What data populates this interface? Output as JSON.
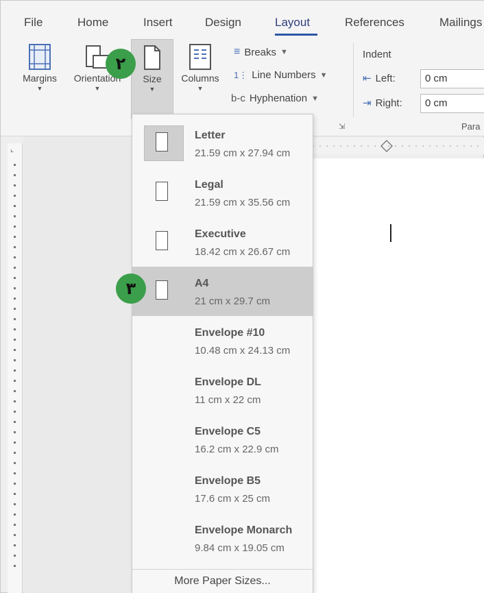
{
  "tabs": [
    "File",
    "Home",
    "Insert",
    "Design",
    "Layout",
    "References",
    "Mailings"
  ],
  "active_tab": "Layout",
  "ribbon": {
    "margins_label": "Margins",
    "orientation_label": "Orientation",
    "size_label": "Size",
    "columns_label": "Columns",
    "breaks_label": "Breaks",
    "line_numbers_label": "Line Numbers",
    "hyphenation_label": "Hyphenation",
    "indent_title": "Indent",
    "indent_left_label": "Left:",
    "indent_left_value": "0 cm",
    "indent_right_label": "Right:",
    "indent_right_value": "0 cm",
    "paragraph_group_label": "Para"
  },
  "size_menu": {
    "items": [
      {
        "name": "Letter",
        "dims": "21.59 cm x 27.94 cm"
      },
      {
        "name": "Legal",
        "dims": "21.59 cm x 35.56 cm"
      },
      {
        "name": "Executive",
        "dims": "18.42 cm x 26.67 cm"
      },
      {
        "name": "A4",
        "dims": "21 cm x 29.7 cm"
      },
      {
        "name": "Envelope #10",
        "dims": "10.48 cm x 24.13 cm"
      },
      {
        "name": "Envelope DL",
        "dims": "11 cm x 22 cm"
      },
      {
        "name": "Envelope C5",
        "dims": "16.2 cm x 22.9 cm"
      },
      {
        "name": "Envelope B5",
        "dims": "17.6 cm x 25 cm"
      },
      {
        "name": "Envelope Monarch",
        "dims": "9.84 cm x 19.05 cm"
      }
    ],
    "selected": "A4",
    "more_label": "More Paper Sizes..."
  },
  "badges": {
    "step_size": "۲",
    "step_a4": "۳"
  },
  "colors": {
    "badge": "#3b9e4a",
    "accent": "#2f56a6",
    "selected_row": "#cdcdcd"
  }
}
